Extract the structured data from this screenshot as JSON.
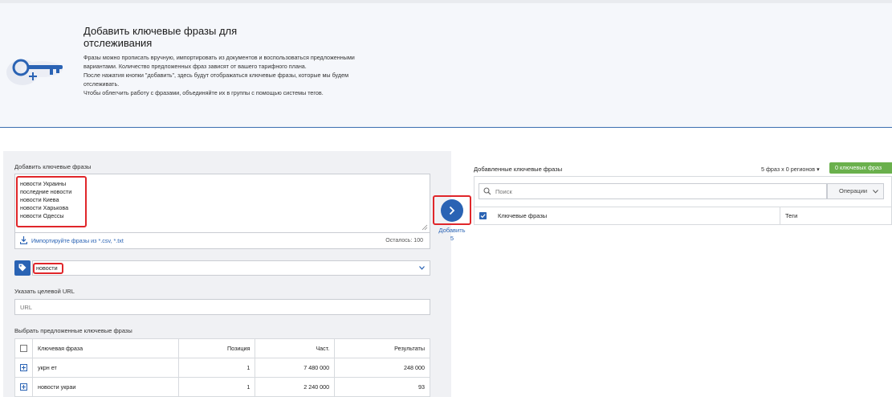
{
  "banner": {
    "title": "Добавить ключевые фразы для отслеживания",
    "paragraphs": [
      "Фразы можно прописать вручную, импортировать из документов и воспользоваться предложенными вариантами. Количество предложенных фраз зависят от вашего тарифного плана.",
      "После нажатия кнопки \"добавить\", здесь будут отображаться ключевые фразы, которые мы будем отслеживать.",
      "Чтобы облегчить работу с фразами, объединяйте их в группы с помощью системы тегов."
    ]
  },
  "left": {
    "add_label": "Добавить ключевые фразы",
    "keywords": [
      "новости Украины",
      "последние новости",
      "новости Киева",
      "новости Харькова",
      "новости Одессы"
    ],
    "import_link": "Импортируйте фразы из *.csv, *.txt",
    "remaining": "Осталось: 100",
    "tag_value": "новости",
    "url_label": "Указать целевой URL",
    "url_placeholder": "URL",
    "suggested_label": "Выбрать предложенные ключевые фразы",
    "table": {
      "headers": [
        "Ключевая фраза",
        "Позиция",
        "Част.",
        "Результаты"
      ],
      "rows": [
        {
          "phrase": "укрн ет",
          "position": "1",
          "freq": "7 480 000",
          "results": "248 000"
        },
        {
          "phrase": "новости украи",
          "position": "1",
          "freq": "2 240 000",
          "results": "93"
        }
      ]
    }
  },
  "add_button": {
    "label": "Добавить",
    "count": "5"
  },
  "right": {
    "title": "Добавленные ключевые фразы",
    "count": "5 фраз x 0 регионов",
    "badge": "0 ключевых фраз",
    "search_placeholder": "Поиск",
    "operations": "Операции",
    "col_phrases": "Ключевые фразы",
    "col_tags": "Теги"
  },
  "colors": {
    "primary": "#2a63b4",
    "highlight": "#e0262a",
    "success": "#6ab04c"
  }
}
